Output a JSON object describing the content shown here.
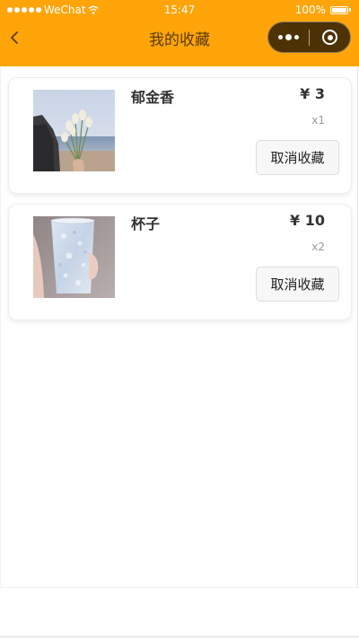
{
  "status_bar": {
    "carrier": "WeChat",
    "time": "15:47",
    "battery": "100%"
  },
  "nav": {
    "title": "我的收藏",
    "back_icon": "chevron-left-icon",
    "more_icon": "more-dots-icon",
    "close_icon": "target-circle-icon"
  },
  "theme": {
    "header_color": "#ffa50a",
    "capsule_color": "#4d3205"
  },
  "favorites": [
    {
      "name": "郁金香",
      "price": "¥ 3",
      "quantity": "x1",
      "button_label": "取消收藏",
      "image": "tulip-bouquet-photo"
    },
    {
      "name": "杯子",
      "price": "¥ 10",
      "quantity": "x2",
      "button_label": "取消收藏",
      "image": "glass-cup-photo"
    }
  ]
}
